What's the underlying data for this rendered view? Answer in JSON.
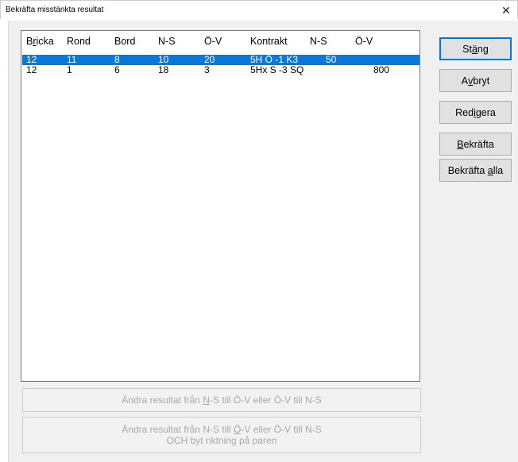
{
  "window": {
    "title": "Bekräfta misstänkta resultat",
    "close_glyph": "✕"
  },
  "list": {
    "headers": [
      "Bricka",
      "Rond",
      "Bord",
      "N-S",
      "Ö-V",
      "Kontrakt",
      "N-S",
      "Ö-V"
    ],
    "rows": [
      {
        "bricka": "12",
        "rond": "11",
        "bord": "8",
        "ns": "10",
        "ov": "20",
        "kontrakt": "5H Ö -1 K3",
        "score_ns": "50",
        "score_ov": "",
        "selected": true
      },
      {
        "bricka": "12",
        "rond": "1",
        "bord": "6",
        "ns": "18",
        "ov": "3",
        "kontrakt": "5Hx S -3 SQ",
        "score_ns": "",
        "score_ov": "800",
        "selected": false
      }
    ]
  },
  "buttons": {
    "stang": {
      "pre": "St",
      "key": "ä",
      "post": "ng"
    },
    "avbryt": {
      "pre": "A",
      "key": "v",
      "post": "bryt"
    },
    "redigera": {
      "pre": "Red",
      "key": "i",
      "post": "gera"
    },
    "bekrafta": {
      "pre": "",
      "key": "B",
      "post": "ekräfta"
    },
    "bekrafta_alla": {
      "pre": "Bekräfta ",
      "key": "a",
      "post": "lla"
    },
    "swap": {
      "line1_pre": "Ändra resultat från ",
      "line1_key": "N",
      "line1_post": "-S till Ö-V eller Ö-V till N-S"
    },
    "swap_flip": {
      "line1_pre": "Ändra resultat från N-S till ",
      "line1_key": "Ö",
      "line1_post": "-V eller Ö-V till N-S",
      "line2": "OCH byt riktning på paren"
    }
  },
  "colors": {
    "selection": "#0a78d7",
    "dialog_bg": "#f0f0f0",
    "disabled_text": "#a8a8a8"
  }
}
